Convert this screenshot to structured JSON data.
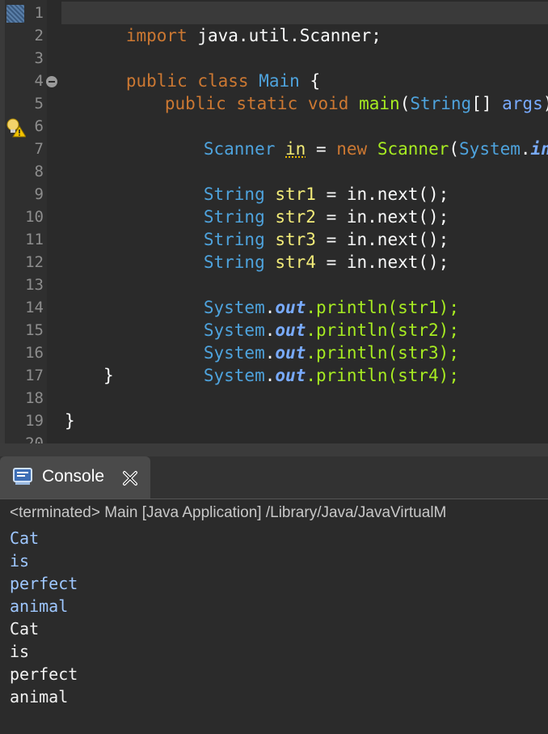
{
  "editor": {
    "line_numbers": [
      "1",
      "2",
      "3",
      "4",
      "5",
      "6",
      "7",
      "8",
      "9",
      "10",
      "11",
      "12",
      "13",
      "14",
      "15",
      "16",
      "17",
      "18",
      "19",
      "20"
    ],
    "lines": {
      "l1_import": "import",
      "l1_pkg": " java.util.Scanner;",
      "l3_public": "public",
      "l3_class": " class ",
      "l3_name": "Main",
      "l3_brace": " {",
      "l4_public": "public",
      "l4_static": " static ",
      "l4_void": "void",
      "l4_sp": " ",
      "l4_main": "main",
      "l4_open": "(",
      "l4_String": "String",
      "l4_arr": "[] ",
      "l4_args": "args",
      "l4_close": ") {",
      "l6_Scanner": "Scanner",
      "l6_sp": " ",
      "l6_in": "in",
      "l6_eq": " = ",
      "l6_new": "new",
      "l6_sp2": " ",
      "l6_Scanner2": "Scanner",
      "l6_paren": "(",
      "l6_System": "System",
      "l6_dot": ".",
      "l6_in2": "in",
      "l6_end": ");",
      "l8_type": "String",
      "l8_var": " str1",
      "l8_rest": " = in.next();",
      "l9_type": "String",
      "l9_var": " str2",
      "l9_rest": " = in.next();",
      "l10_type": "String",
      "l10_var": " str3",
      "l10_rest": " = in.next();",
      "l11_type": "String",
      "l11_var": " str4",
      "l11_rest": " = in.next();",
      "l13_sys": "System",
      "l13_dot": ".",
      "l13_out": "out",
      "l13_rest": ".println(str1);",
      "l14_sys": "System",
      "l14_dot": ".",
      "l14_out": "out",
      "l14_rest": ".println(str2);",
      "l15_sys": "System",
      "l15_dot": ".",
      "l15_out": "out",
      "l15_rest": ".println(str3);",
      "l16_sys": "System",
      "l16_dot": ".",
      "l16_out": "out",
      "l16_rest": ".println(str4);",
      "l17": "}",
      "l19": "}"
    }
  },
  "console": {
    "tab_label": "Console",
    "tab_icon": "console-icon",
    "close_icon": "close-icon",
    "header": "<terminated> Main [Java Application] /Library/Java/JavaVirtualM",
    "stdin_lines": [
      "Cat",
      "is",
      "perfect",
      "animal"
    ],
    "stdout_lines": [
      "Cat",
      "is",
      "perfect",
      "animal"
    ]
  },
  "colors": {
    "keyword": "#cc7832",
    "type": "#4ea3dd",
    "method": "#a7ec21",
    "local_var": "#f3ec79",
    "static_field": "#79abff",
    "stdin": "#9ec7ff",
    "stdout": "#f2f2f2"
  }
}
